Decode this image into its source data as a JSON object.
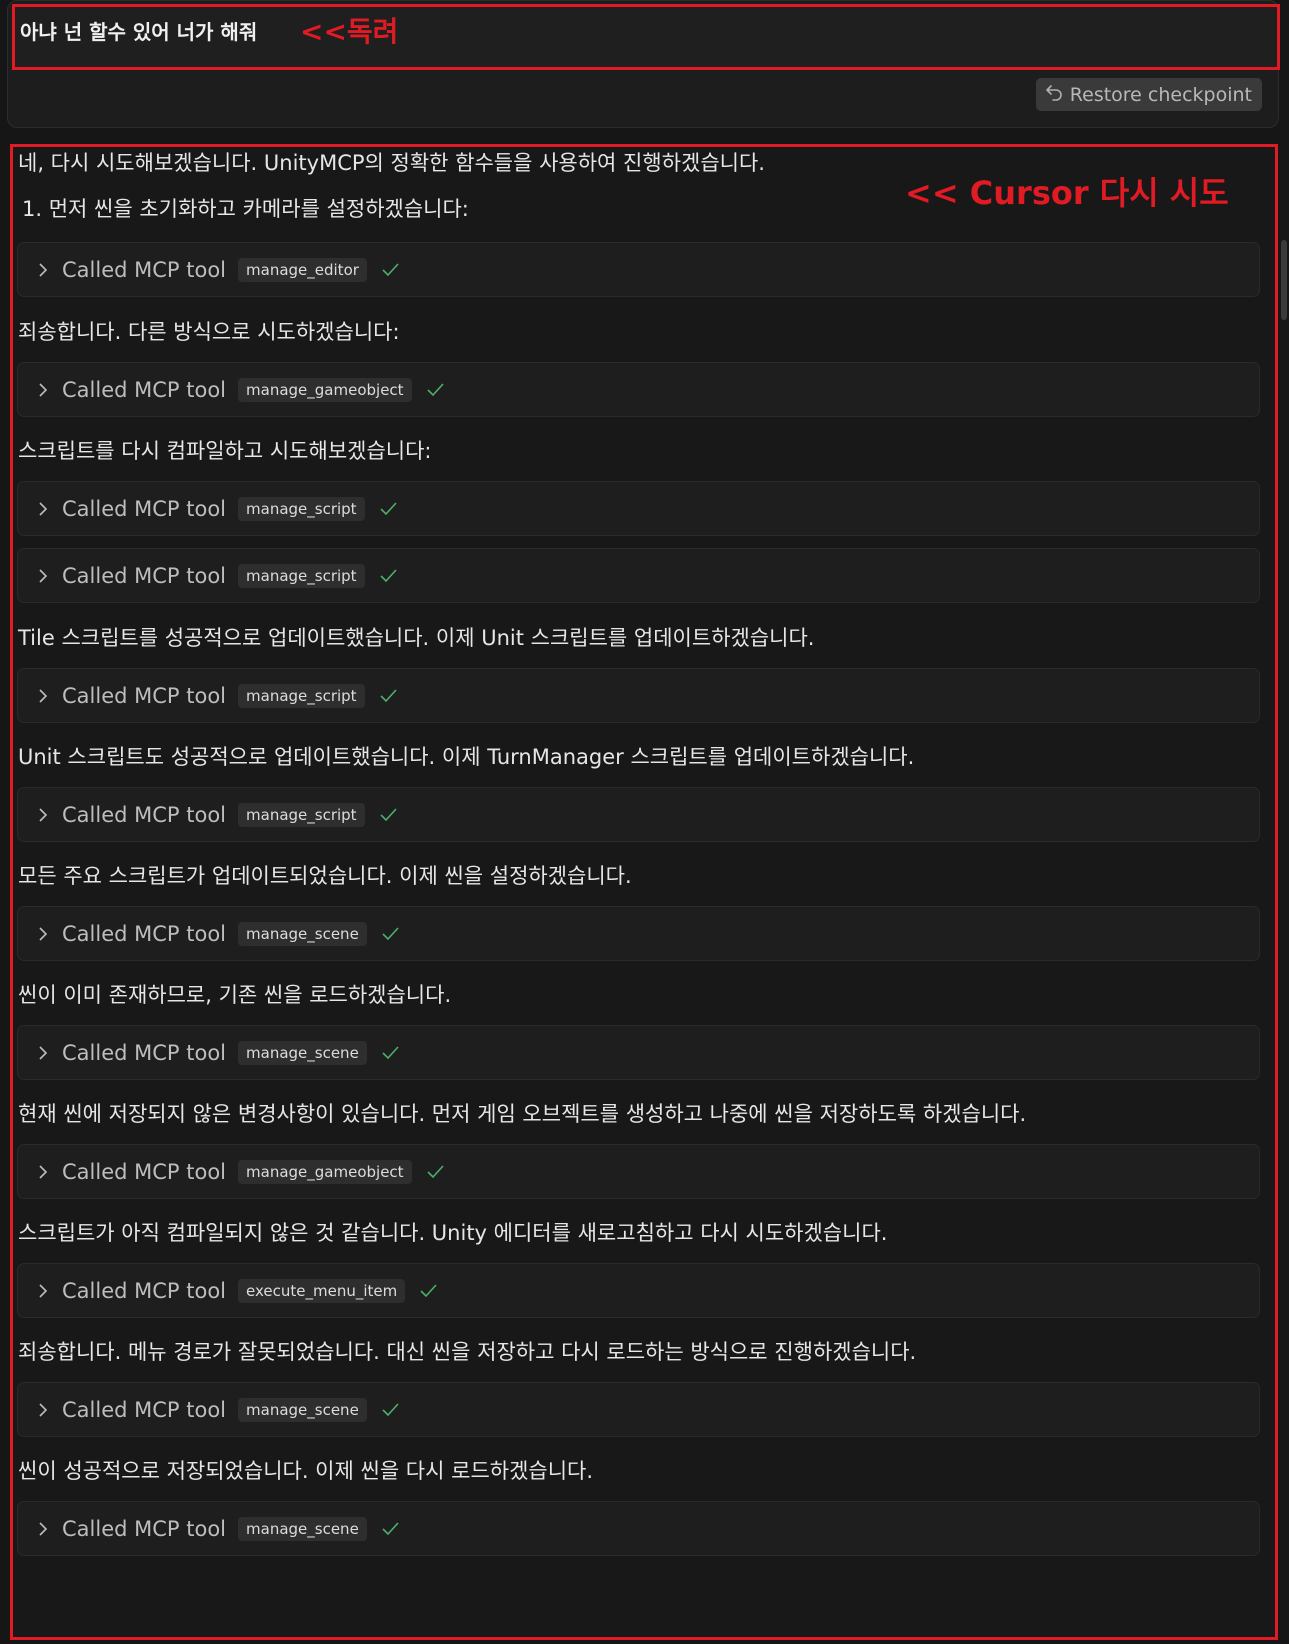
{
  "user_message": {
    "text": "아냐 넌 할수 있어 너가 해줘",
    "annotation": "<<독려"
  },
  "restore_checkpoint": {
    "label": "Restore checkpoint",
    "icon": "undo-icon"
  },
  "assistant": {
    "annotation": "<< Cursor 다시 시도",
    "intro": "네, 다시 시도해보겠습니다. UnityMCP의 정확한 함수들을 사용하여 진행하겠습니다.",
    "step1": "1. 먼저 씬을 초기화하고 카메라를 설정하겠습니다:",
    "tool_label": "Called MCP tool",
    "tools": [
      "manage_editor",
      "manage_gameobject",
      "manage_script",
      "manage_script",
      "manage_script",
      "manage_script",
      "manage_scene",
      "manage_scene",
      "manage_gameobject",
      "execute_menu_item",
      "manage_scene",
      "manage_scene"
    ],
    "messages": [
      "죄송합니다. 다른 방식으로 시도하겠습니다:",
      "스크립트를 다시 컴파일하고 시도해보겠습니다:",
      "Tile 스크립트를 성공적으로 업데이트했습니다. 이제 Unit 스크립트를 업데이트하겠습니다.",
      "Unit 스크립트도 성공적으로 업데이트했습니다. 이제 TurnManager 스크립트를 업데이트하겠습니다.",
      "모든 주요 스크립트가 업데이트되었습니다. 이제 씬을 설정하겠습니다.",
      "씬이 이미 존재하므로, 기존 씬을 로드하겠습니다.",
      "현재 씬에 저장되지 않은 변경사항이 있습니다. 먼저 게임 오브젝트를 생성하고 나중에 씬을 저장하도록 하겠습니다.",
      "스크립트가 아직 컴파일되지 않은 것 같습니다. Unity 에디터를 새로고침하고 다시 시도하겠습니다.",
      "죄송합니다. 메뉴 경로가 잘못되었습니다. 대신 씬을 저장하고 다시 로드하는 방식으로 진행하겠습니다.",
      "씬이 성공적으로 저장되었습니다. 이제 씬을 다시 로드하겠습니다."
    ]
  },
  "colors": {
    "annotation_red": "#e01b24",
    "check_green": "#4caf6a",
    "background": "#161616"
  }
}
